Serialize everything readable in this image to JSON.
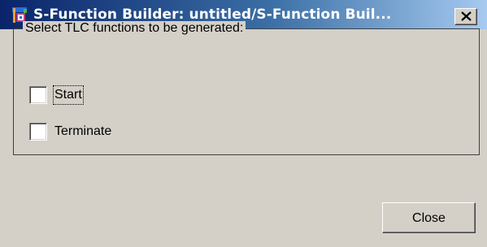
{
  "window": {
    "title": "S-Function Builder: untitled/S-Function Buil...",
    "icon": "matlab-simulink-icon",
    "close_icon": "close-icon"
  },
  "group": {
    "legend": "Select TLC functions to be generated:",
    "checkboxes": [
      {
        "label": "Start",
        "checked": false,
        "focused": true
      },
      {
        "label": "Terminate",
        "checked": false,
        "focused": false
      }
    ]
  },
  "buttons": {
    "close_label": "Close"
  },
  "colors": {
    "title_start": "#0a246a",
    "title_end": "#a6caf0",
    "face": "#d4d0c8"
  }
}
